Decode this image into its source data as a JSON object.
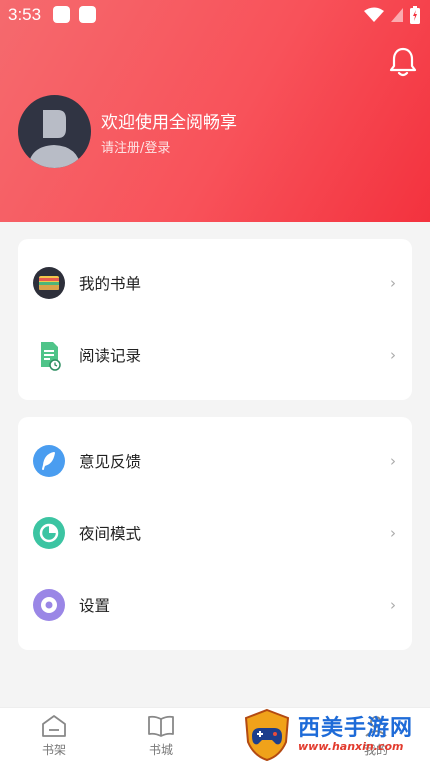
{
  "status_bar": {
    "time": "3:53"
  },
  "profile": {
    "welcome": "欢迎使用全阅畅享",
    "login_hint": "请注册/登录"
  },
  "menu_group_1": [
    {
      "label": "我的书单",
      "icon": "wallet-icon"
    },
    {
      "label": "阅读记录",
      "icon": "reading-history-icon"
    }
  ],
  "menu_group_2": [
    {
      "label": "意见反馈",
      "icon": "feather-icon"
    },
    {
      "label": "夜间模式",
      "icon": "pie-chart-icon"
    },
    {
      "label": "设置",
      "icon": "gear-icon"
    }
  ],
  "chevron": "›",
  "tabbar": {
    "tabs": [
      {
        "label": "书架",
        "icon": "bookshelf-icon"
      },
      {
        "label": "书城",
        "icon": "open-book-icon"
      },
      {
        "label": "我的",
        "icon": "profile-icon"
      }
    ]
  },
  "watermark": {
    "title": "西美手游网",
    "url": "www.hanxin.com"
  },
  "colors": {
    "header_start": "#f56a6e",
    "header_end": "#f3323e",
    "feedback_icon": "#4a9df0",
    "night_icon": "#3cc4a2",
    "settings_icon": "#9a86e6"
  }
}
